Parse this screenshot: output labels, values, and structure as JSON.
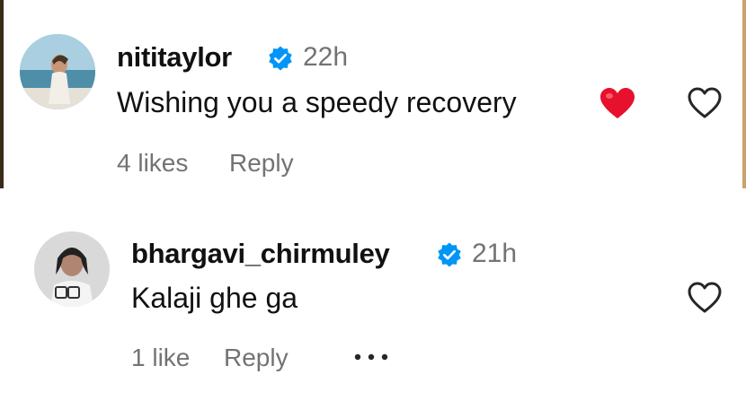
{
  "comments": [
    {
      "username": "nititaylor",
      "verified": true,
      "time": "22h",
      "text": "Wishing you a speedy recovery",
      "emoji": "red-heart",
      "likes": "4 likes",
      "reply": "Reply"
    },
    {
      "username": "bhargavi_chirmuley",
      "verified": true,
      "time": "21h",
      "text": "Kalaji ghe ga",
      "likes": "1 like",
      "reply": "Reply",
      "more_icon": "ellipsis-icon"
    }
  ],
  "colors": {
    "verified_badge": "#0095F6",
    "secondary_text": "#737373",
    "emoji_heart": "#E8112D"
  },
  "icons": [
    "verified-badge-icon",
    "heart-outline-icon",
    "red-heart-emoji",
    "ellipsis-icon"
  ]
}
